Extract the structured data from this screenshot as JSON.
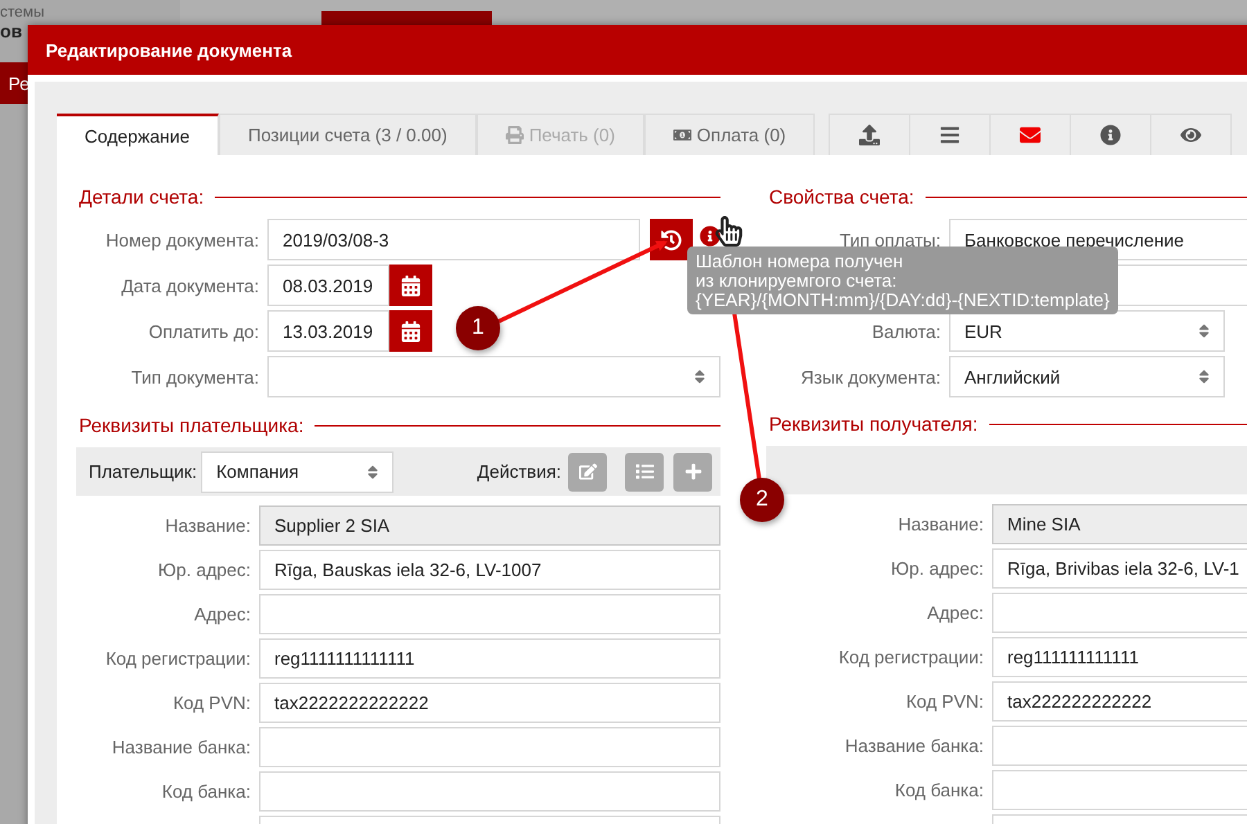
{
  "background": {
    "sidebar": {
      "subtitle": "стемы",
      "title": "ов",
      "menu_item": "Ре"
    }
  },
  "window": {
    "title": "Редактирование документа"
  },
  "tabs": [
    {
      "label": "Содержание",
      "selected": true,
      "disabled": false
    },
    {
      "label": "Позиции счета (3 / 0.00)",
      "selected": false,
      "disabled": false
    },
    {
      "label": "Печать (0)",
      "selected": false,
      "disabled": true,
      "kind": "print"
    },
    {
      "label": "Оплата (0)",
      "selected": false,
      "disabled": false,
      "kind": "money"
    }
  ],
  "icon_tabs": [
    {
      "kind": "upload",
      "highlighted": false
    },
    {
      "kind": "list",
      "highlighted": false
    },
    {
      "kind": "envelope",
      "highlighted": true
    },
    {
      "kind": "info",
      "highlighted": false
    },
    {
      "kind": "eye",
      "highlighted": false
    }
  ],
  "invoice_details": {
    "heading": "Детали счета:",
    "fields": [
      {
        "kind": "number",
        "label": "Номер документа:",
        "value": "2019/03/08-3"
      },
      {
        "kind": "date",
        "label": "Дата документа:",
        "value": "08.03.2019"
      },
      {
        "kind": "date",
        "label": "Оплатить до:",
        "value": "13.03.2019"
      },
      {
        "kind": "select",
        "label": "Тип документа:"
      }
    ]
  },
  "tooltip": {
    "lines": [
      "Шаблон номера получен",
      "из клонируемгого счета:",
      "{YEAR}/{MONTH:mm}/{DAY:dd}-{NEXTID:template}"
    ]
  },
  "invoice_properties": {
    "heading": "Свойства счета:",
    "fields": [
      {
        "kind": "text",
        "label": "Тип оплаты:",
        "value": "Банковское перечисление"
      },
      {
        "kind": "text"
      },
      {
        "kind": "select",
        "label": "Валюта:",
        "value": "EUR"
      },
      {
        "kind": "select",
        "label": "Язык документа:",
        "value": "Английский"
      }
    ]
  },
  "payer": {
    "heading": "Реквизиты плательщика:",
    "payer_label": "Плательщик:",
    "payer_type": "Компания",
    "actions_label": "Действия:",
    "action_buttons": [
      {
        "kind": "edit"
      },
      {
        "kind": "list"
      },
      {
        "kind": "plus"
      }
    ],
    "fields": [
      {
        "label": "Название:",
        "value": "Supplier 2 SIA",
        "readonly": true
      },
      {
        "label": "Юр. адрес:",
        "value": "Rīga, Bauskas iela 32-6, LV-1007",
        "readonly": false
      },
      {
        "label": "Адрес:",
        "readonly": false
      },
      {
        "label": "Код регистрации:",
        "value": "reg1111111111111",
        "readonly": false
      },
      {
        "label": "Код PVN:",
        "value": "tax2222222222222",
        "readonly": false
      },
      {
        "label": "Название банка:",
        "readonly": false
      },
      {
        "label": "Код банка:",
        "readonly": false
      },
      {
        "readonly": false
      }
    ]
  },
  "recipient": {
    "heading": "Реквизиты получателя:",
    "fields": [
      {
        "label": "Название:",
        "value": "Mine SIA",
        "readonly": true
      },
      {
        "label": "Юр. адрес:",
        "value": "Rīga, Brivibas iela 32-6, LV-1",
        "readonly": false
      },
      {
        "label": "Адрес:",
        "readonly": false
      },
      {
        "label": "Код регистрации:",
        "value": "reg111111111111",
        "readonly": false
      },
      {
        "label": "Код PVN:",
        "value": "tax222222222222",
        "readonly": false
      },
      {
        "label": "Название банка:",
        "readonly": false
      },
      {
        "label": "Код банка:",
        "readonly": false
      },
      {
        "readonly": false
      }
    ]
  },
  "annotations": [
    {
      "number": "1"
    },
    {
      "number": "2"
    }
  ]
}
